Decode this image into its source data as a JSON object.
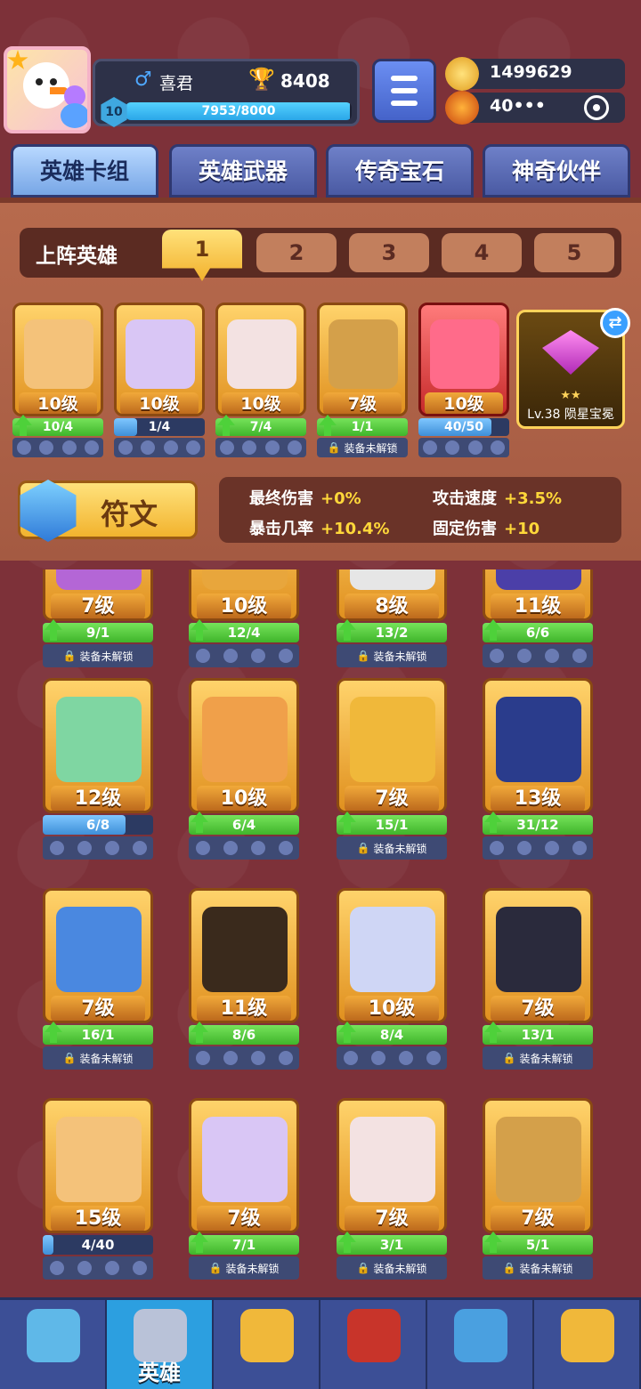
{
  "player": {
    "gender_symbol": "♂",
    "name": "喜君",
    "trophies": "8408",
    "level": "10",
    "xp_text": "7953/8000",
    "xp_fraction": 0.994
  },
  "currency": {
    "coins": "1499629",
    "energy": "40•••"
  },
  "tabs": [
    "英雄卡组",
    "英雄武器",
    "传奇宝石",
    "神奇伙伴"
  ],
  "lineup": {
    "label": "上阵英雄",
    "slots": [
      "1",
      "2",
      "3",
      "4",
      "5"
    ]
  },
  "deck": [
    {
      "level": "10级",
      "progress": "10/4",
      "upgrade": true,
      "fill": 1.0,
      "locked": false
    },
    {
      "level": "10级",
      "progress": "1/4",
      "upgrade": false,
      "fill": 0.25,
      "locked": false
    },
    {
      "level": "10级",
      "progress": "7/4",
      "upgrade": true,
      "fill": 1.0,
      "locked": false
    },
    {
      "level": "7级",
      "progress": "1/1",
      "upgrade": true,
      "fill": 1.0,
      "locked": true
    },
    {
      "level": "10级",
      "progress": "40/50",
      "upgrade": false,
      "fill": 0.8,
      "locked": false
    }
  ],
  "legend_gem": {
    "stars": "★★",
    "name": "Lv.38 陨星宝冕",
    "swap": "⇄"
  },
  "rune": {
    "label": "符文"
  },
  "stats": [
    {
      "label": "最终伤害",
      "value": "+0%"
    },
    {
      "label": "攻击速度",
      "value": "+3.5%"
    },
    {
      "label": "暴击几率",
      "value": "+10.4%"
    },
    {
      "label": "固定伤害",
      "value": "+10"
    }
  ],
  "lock_text": "装备未解锁",
  "heroes": [
    {
      "level": "7级",
      "progress": "9/1",
      "upgrade": true,
      "fill": 1.0,
      "locked": true
    },
    {
      "level": "10级",
      "progress": "12/4",
      "upgrade": true,
      "fill": 1.0,
      "locked": false
    },
    {
      "level": "8级",
      "progress": "13/2",
      "upgrade": true,
      "fill": 1.0,
      "locked": true
    },
    {
      "level": "11级",
      "progress": "6/6",
      "upgrade": true,
      "fill": 1.0,
      "locked": false
    },
    {
      "level": "12级",
      "progress": "6/8",
      "upgrade": false,
      "fill": 0.75,
      "locked": false
    },
    {
      "level": "10级",
      "progress": "6/4",
      "upgrade": true,
      "fill": 1.0,
      "locked": false
    },
    {
      "level": "7级",
      "progress": "15/1",
      "upgrade": true,
      "fill": 1.0,
      "locked": true
    },
    {
      "level": "13级",
      "progress": "31/12",
      "upgrade": true,
      "fill": 1.0,
      "locked": false
    },
    {
      "level": "7级",
      "progress": "16/1",
      "upgrade": true,
      "fill": 1.0,
      "locked": true
    },
    {
      "level": "11级",
      "progress": "8/6",
      "upgrade": true,
      "fill": 1.0,
      "locked": false
    },
    {
      "level": "10级",
      "progress": "8/4",
      "upgrade": true,
      "fill": 1.0,
      "locked": false
    },
    {
      "level": "7级",
      "progress": "13/1",
      "upgrade": true,
      "fill": 1.0,
      "locked": true
    },
    {
      "level": "15级",
      "progress": "4/40",
      "upgrade": false,
      "fill": 0.1,
      "locked": false
    },
    {
      "level": "7级",
      "progress": "7/1",
      "upgrade": true,
      "fill": 1.0,
      "locked": true
    },
    {
      "level": "7级",
      "progress": "3/1",
      "upgrade": true,
      "fill": 1.0,
      "locked": true
    },
    {
      "level": "7级",
      "progress": "5/1",
      "upgrade": true,
      "fill": 1.0,
      "locked": true
    }
  ],
  "nav": [
    {
      "icon": "treasure-chest-icon",
      "label": ""
    },
    {
      "icon": "knight-helmet-icon",
      "label": "英雄"
    },
    {
      "icon": "crossed-swords-icon",
      "label": ""
    },
    {
      "icon": "crown-shield-icon",
      "label": ""
    },
    {
      "icon": "guild-banner-icon",
      "label": ""
    },
    {
      "icon": "compass-icon",
      "label": ""
    }
  ],
  "colors": {
    "face_palette": [
      "#f4c27a",
      "#d9c6f5",
      "#f3e2e2",
      "#d4a04a",
      "#ff6b8a",
      "#b466d6",
      "#e8a63c",
      "#e6e6e6",
      "#4b3fa8",
      "#7fd6a2",
      "#f0a04a",
      "#f0b83a",
      "#2a3c8c",
      "#4a88e0",
      "#3a2a1c",
      "#cfd6f5",
      "#2a2a3c"
    ]
  }
}
